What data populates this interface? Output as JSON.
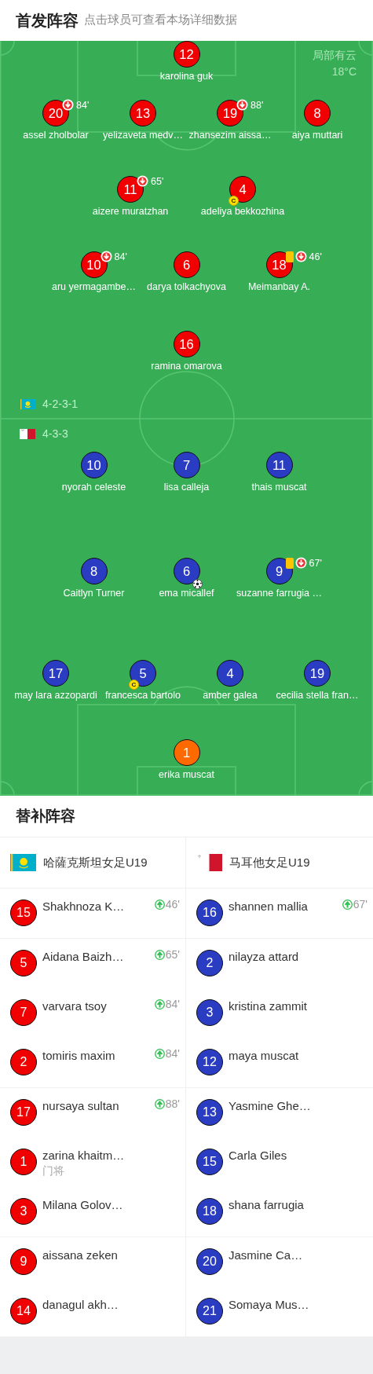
{
  "header": {
    "title": "首发阵容",
    "subtitle": "点击球员可查看本场详细数据"
  },
  "pitch": {
    "weather": "局部有云",
    "temperature": "18°C",
    "home": {
      "flag": {
        "kind": "kz"
      },
      "formation": "4-2-3-1",
      "lines": [
        [
          {
            "number": "12",
            "name": "karolina guk",
            "color": "#f00000"
          }
        ],
        [
          {
            "number": "20",
            "name": "assel zholbolar",
            "color": "#f00000",
            "events": [
              {
                "kind": "sub_off",
                "minute": "84'"
              }
            ]
          },
          {
            "number": "13",
            "name": "yelizaveta medv…",
            "color": "#f00000"
          },
          {
            "number": "19",
            "name": "zhansezim aissa…",
            "color": "#f00000",
            "events": [
              {
                "kind": "sub_off",
                "minute": "88'"
              }
            ]
          },
          {
            "number": "8",
            "name": "aiya muttari",
            "color": "#f00000"
          }
        ],
        [
          {
            "number": "11",
            "name": "aizere muratzhan",
            "color": "#f00000",
            "events": [
              {
                "kind": "sub_off",
                "minute": "65'"
              }
            ]
          },
          {
            "number": "4",
            "name": "adeliya bekkozhina",
            "color": "#f00000",
            "events": [
              {
                "kind": "captain",
                "label": "C"
              }
            ]
          }
        ],
        [
          {
            "number": "10",
            "name": "aru yermagambe…",
            "color": "#f00000",
            "events": [
              {
                "kind": "sub_off",
                "minute": "84'"
              }
            ]
          },
          {
            "number": "6",
            "name": "darya tolkachyova",
            "color": "#f00000"
          },
          {
            "number": "18",
            "name": "Meimanbay A.",
            "color": "#f00000",
            "events": [
              {
                "kind": "yellow_card"
              },
              {
                "kind": "sub_off",
                "minute": "46'"
              }
            ]
          }
        ],
        [
          {
            "number": "16",
            "name": "ramina omarova",
            "color": "#f00000"
          }
        ]
      ]
    },
    "away": {
      "flag": {
        "kind": "mt"
      },
      "formation": "4-3-3",
      "lines": [
        [
          {
            "number": "10",
            "name": "nyorah celeste",
            "color": "#2a3cc2"
          },
          {
            "number": "7",
            "name": "lisa calleja",
            "color": "#2a3cc2"
          },
          {
            "number": "11",
            "name": "thais muscat",
            "color": "#2a3cc2"
          }
        ],
        [
          {
            "number": "8",
            "name": "Caitlyn Turner",
            "color": "#2a3cc2"
          },
          {
            "number": "6",
            "name": "ema micallef",
            "color": "#2a3cc2",
            "events": [
              {
                "kind": "goal"
              }
            ]
          },
          {
            "number": "9",
            "name": "suzanne farrugia …",
            "color": "#2a3cc2",
            "events": [
              {
                "kind": "yellow_card"
              },
              {
                "kind": "sub_off",
                "minute": "67'"
              }
            ]
          }
        ],
        [
          {
            "number": "17",
            "name": "may lara azzopardi",
            "color": "#2a3cc2"
          },
          {
            "number": "5",
            "name": "francesca bartolo",
            "color": "#2a3cc2",
            "events": [
              {
                "kind": "captain",
                "label": "C"
              }
            ]
          },
          {
            "number": "4",
            "name": "amber galea",
            "color": "#2a3cc2"
          },
          {
            "number": "19",
            "name": "cecilia stella fran…",
            "color": "#2a3cc2"
          }
        ],
        [
          {
            "number": "1",
            "name": "erika muscat",
            "color": "#ff6a00"
          }
        ]
      ]
    }
  },
  "bench": {
    "title": "替补阵容",
    "teams": [
      {
        "flag": {
          "kind": "kz"
        },
        "name": "哈薩克斯坦女足U19",
        "color": "#f00000"
      },
      {
        "flag": {
          "kind": "mt"
        },
        "name": "马耳他女足U19",
        "color": "#2a3cc2"
      }
    ],
    "groups": [
      [
        {
          "home": {
            "number": "15",
            "name": "Shakhnoza K…",
            "minute": "46'"
          },
          "away": {
            "number": "16",
            "name": "shannen mallia",
            "minute": "67'"
          }
        }
      ],
      [
        {
          "home": {
            "number": "5",
            "name": "Aidana Baizh…",
            "minute": "65'"
          },
          "away": {
            "number": "2",
            "name": "nilayza attard"
          }
        },
        {
          "home": {
            "number": "7",
            "name": "varvara tsoy",
            "minute": "84'"
          },
          "away": {
            "number": "3",
            "name": "kristina zammit"
          }
        },
        {
          "home": {
            "number": "2",
            "name": "tomiris maxim",
            "minute": "84'"
          },
          "away": {
            "number": "12",
            "name": "maya muscat"
          }
        }
      ],
      [
        {
          "home": {
            "number": "17",
            "name": "nursaya sultan",
            "minute": "88'"
          },
          "away": {
            "number": "13",
            "name": "Yasmine Ghe…"
          }
        },
        {
          "home": {
            "number": "1",
            "name": "zarina khaitm…",
            "role": "门将"
          },
          "away": {
            "number": "15",
            "name": "Carla Giles"
          }
        },
        {
          "home": {
            "number": "3",
            "name": "Milana Golov…"
          },
          "away": {
            "number": "18",
            "name": "shana farrugia"
          }
        }
      ],
      [
        {
          "home": {
            "number": "9",
            "name": "aissana zeken"
          },
          "away": {
            "number": "20",
            "name": "Jasmine Ca…"
          }
        },
        {
          "home": {
            "number": "14",
            "name": "danagul akh…"
          },
          "away": {
            "number": "21",
            "name": "Somaya Mus…"
          }
        }
      ]
    ]
  }
}
